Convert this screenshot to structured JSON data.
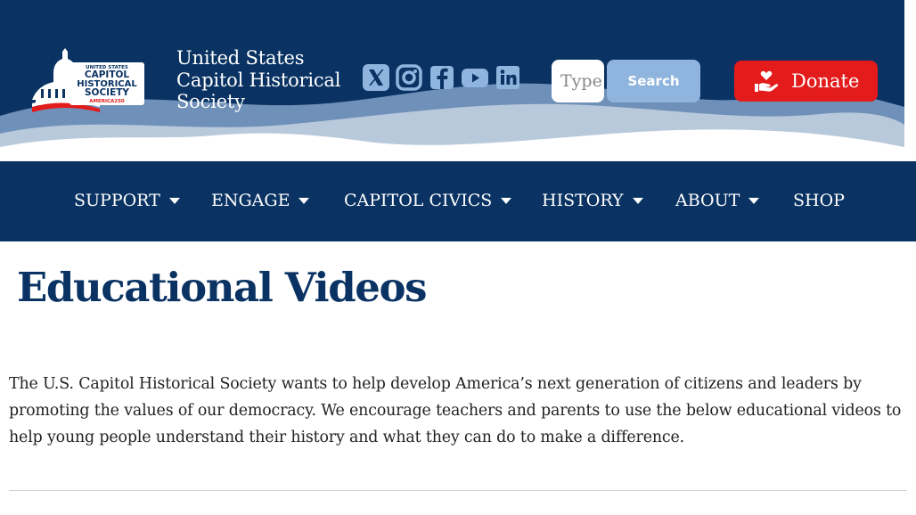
{
  "header": {
    "logo": {
      "line1": "UNITED STATES",
      "line2": "CAPITOL",
      "line3": "HISTORICAL",
      "line4": "SOCIETY",
      "line5": "AMERICA250"
    },
    "site_title_line1": "United States",
    "site_title_line2": "Capitol Historical",
    "site_title_line3": "Society",
    "social": [
      {
        "icon": "x-twitter-icon"
      },
      {
        "icon": "instagram-icon"
      },
      {
        "icon": "facebook-icon"
      },
      {
        "icon": "youtube-icon"
      },
      {
        "icon": "linkedin-icon"
      }
    ],
    "search": {
      "placeholder": "Type",
      "button_label": "Search"
    },
    "donate_label": "Donate"
  },
  "nav": {
    "items": [
      {
        "label": "SUPPORT",
        "has_dropdown": true
      },
      {
        "label": "ENGAGE",
        "has_dropdown": true
      },
      {
        "label": "CAPITOL CIVICS",
        "has_dropdown": true
      },
      {
        "label": "HISTORY",
        "has_dropdown": true
      },
      {
        "label": "ABOUT",
        "has_dropdown": true
      },
      {
        "label": "SHOP",
        "has_dropdown": false
      }
    ]
  },
  "main": {
    "title": "Educational Videos",
    "intro": "The U.S. Capitol Historical Society wants to help develop America’s next generation of citizens and leaders by promoting the values of our democracy. We encourage teachers and parents to use the below educational videos to help young people understand their history and what they can do to make a difference."
  },
  "colors": {
    "navy": "#0a3363",
    "search_button": "#8fb4dd",
    "donate": "#e31b1b",
    "title": "#0a3363"
  }
}
